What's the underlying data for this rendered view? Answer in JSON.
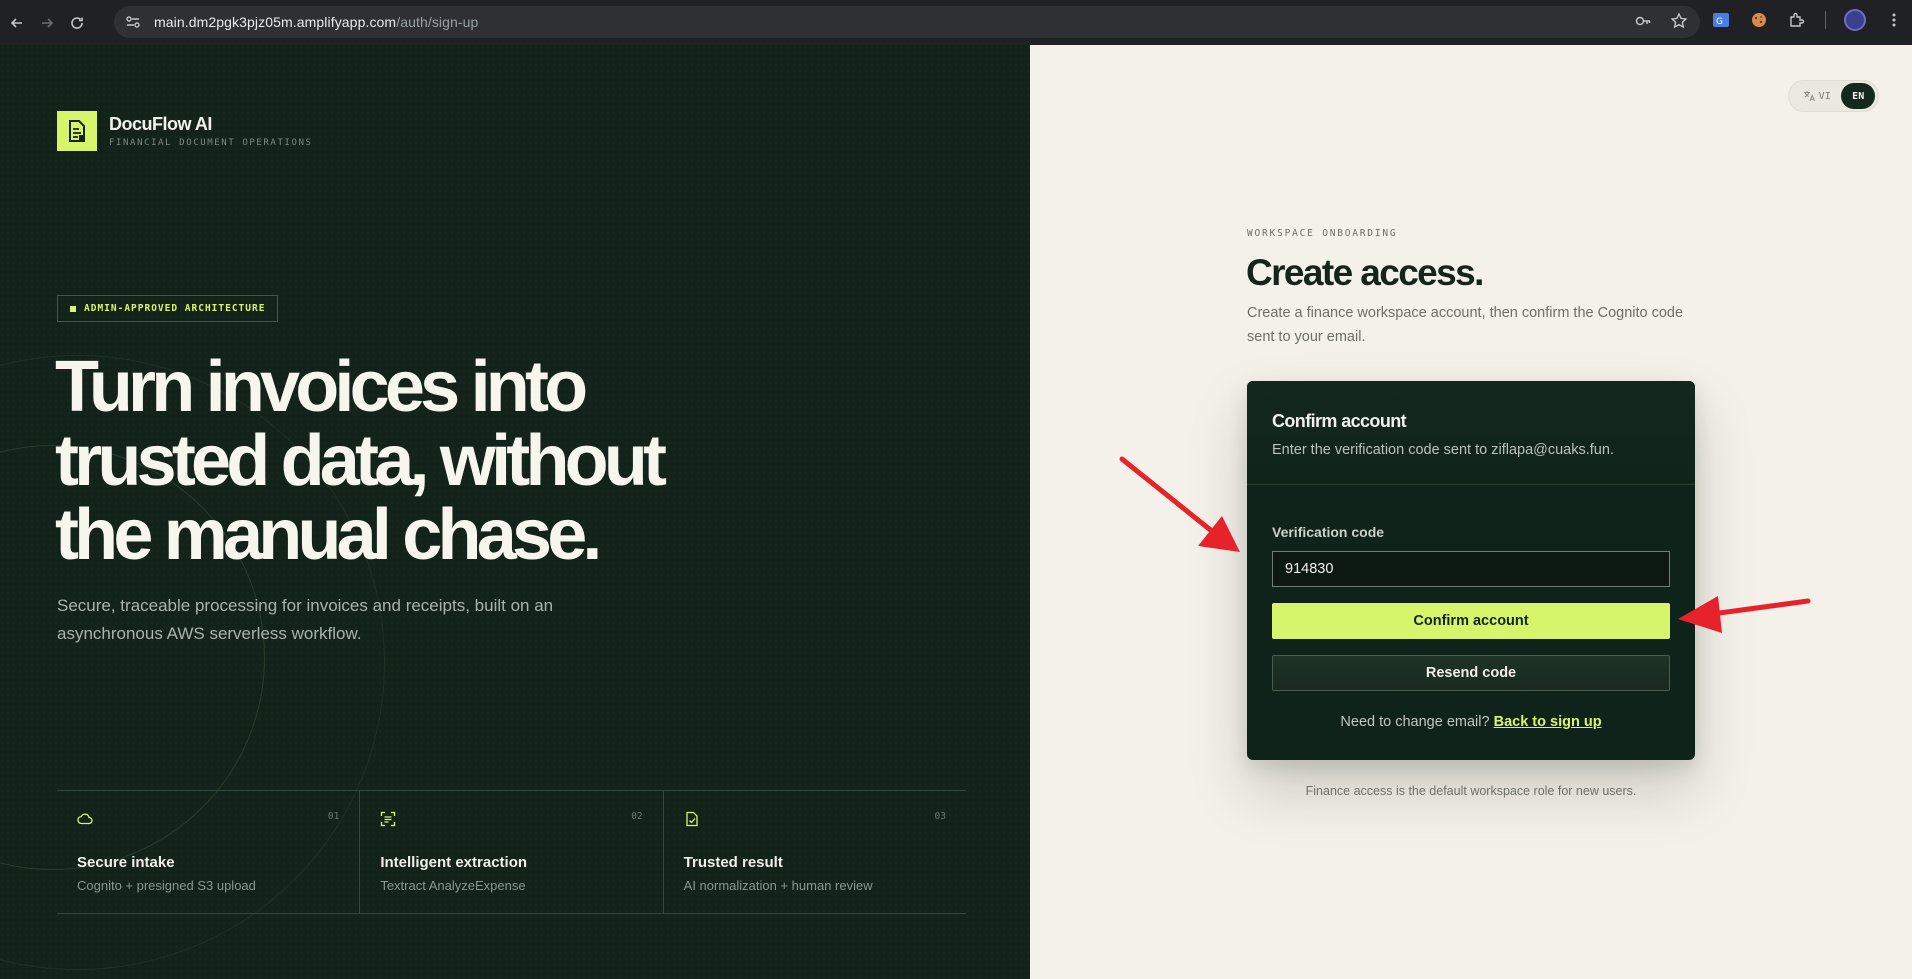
{
  "browser": {
    "url_host": "main.dm2pgk3pjz05m.amplifyapp.com",
    "url_path": "/auth/sign-up"
  },
  "brand": {
    "name": "DocuFlow AI",
    "tagline": "FINANCIAL DOCUMENT OPERATIONS",
    "accent": "#d7f56b"
  },
  "hero": {
    "badge": "ADMIN-APPROVED ARCHITECTURE",
    "headline_lines": [
      "Turn invoices into",
      "trusted data, without",
      "the manual chase."
    ],
    "subtext": "Secure, traceable processing for invoices and receipts, built on an asynchronous AWS serverless workflow."
  },
  "features": [
    {
      "icon": "cloud-icon",
      "number": "01",
      "title": "Secure intake",
      "desc": "Cognito + presigned S3 upload"
    },
    {
      "icon": "scan-icon",
      "number": "02",
      "title": "Intelligent extraction",
      "desc": "Textract AnalyzeExpense"
    },
    {
      "icon": "file-check-icon",
      "number": "03",
      "title": "Trusted result",
      "desc": "AI normalization + human review"
    }
  ],
  "language": {
    "options": [
      "VI",
      "EN"
    ],
    "selected": "EN"
  },
  "onboarding": {
    "eyebrow": "WORKSPACE ONBOARDING",
    "title": "Create access.",
    "description": "Create a finance workspace account, then confirm the Cognito code sent to your email."
  },
  "confirm_card": {
    "title": "Confirm account",
    "subtitle": "Enter the verification code sent to ziflapa@cuaks.fun.",
    "field_label": "Verification code",
    "field_value": "914830",
    "confirm_button": "Confirm account",
    "resend_button": "Resend code",
    "footer_prompt": "Need to change email?",
    "footer_link": "Back to sign up"
  },
  "note": "Finance access is the default workspace role for new users.",
  "colors": {
    "dark_panel": "#132319",
    "light_panel": "#f4f1ea",
    "card": "#10231a",
    "annotation_arrow": "#e8222a"
  }
}
